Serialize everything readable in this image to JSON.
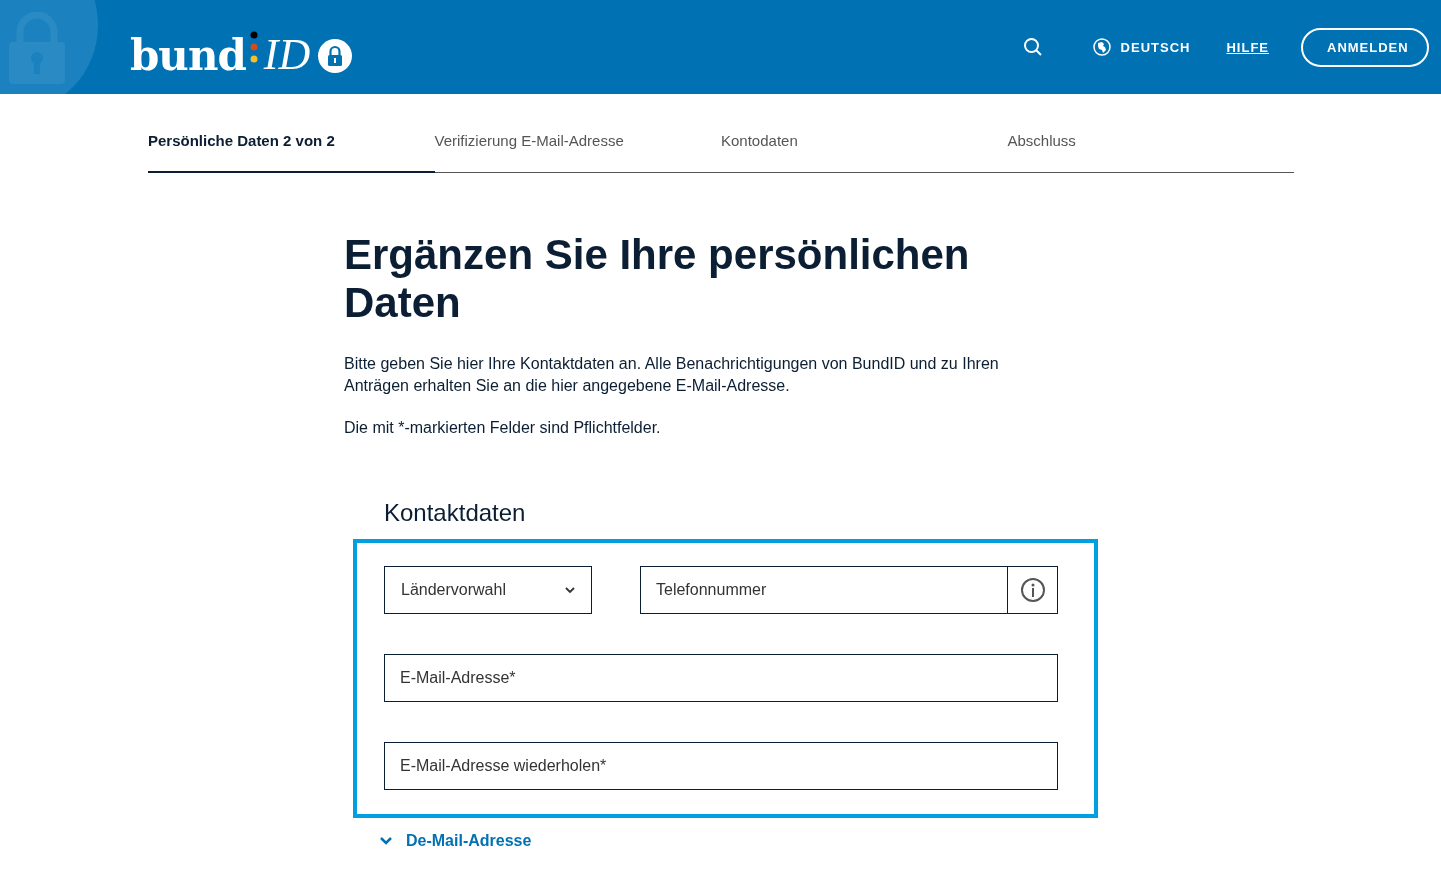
{
  "header": {
    "logo": {
      "word": "bund",
      "suffix": "ID"
    },
    "language": "DEUTSCH",
    "help": "HILFE",
    "login": "ANMELDEN"
  },
  "steps": [
    {
      "label": "Persönliche Daten 2 von 2",
      "selected": true
    },
    {
      "label": "Verifizierung E-Mail-Adresse",
      "selected": false
    },
    {
      "label": "Kontodaten",
      "selected": false
    },
    {
      "label": "Abschluss",
      "selected": false
    }
  ],
  "heading": "Ergänzen Sie Ihre persönlichen Daten",
  "intro": "Bitte geben Sie hier Ihre Kontaktdaten an. Alle Benachrichtigungen von BundID und zu Ihren Anträgen erhalten Sie an die hier angegebene E-Mail-Adresse.",
  "required_note": "Die mit *-markierten Felder sind Pflichtfelder.",
  "section": {
    "title": "Kontaktdaten",
    "country_select": "Ländervorwahl",
    "phone": {
      "placeholder": "Telefonnummer"
    },
    "fields": [
      {
        "placeholder": "E-Mail-Adresse*"
      },
      {
        "placeholder": "E-Mail-Adresse wiederholen*"
      }
    ]
  },
  "expander": {
    "label": "De-Mail-Adresse",
    "expanded": false
  }
}
